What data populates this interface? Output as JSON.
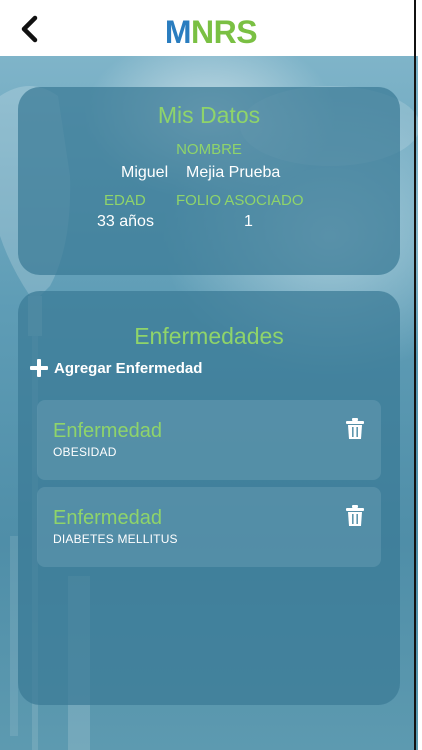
{
  "header": {
    "logo_m": "M",
    "logo_rest": "NRS",
    "back_icon": "chevron-left-icon"
  },
  "datos": {
    "title": "Mis Datos",
    "nombre_label": "NOMBRE",
    "nombre_first": "Miguel",
    "nombre_last": "Mejia Prueba",
    "edad_label": "EDAD",
    "edad_value": "33 años",
    "folio_label": "FOLIO ASOCIADO",
    "folio_value": "1"
  },
  "enfermedades": {
    "title": "Enfermedades",
    "add_label": "Agregar Enfermedad",
    "items": [
      {
        "title": "Enfermedad",
        "name": "OBESIDAD"
      },
      {
        "title": "Enfermedad",
        "name": "DIABETES MELLITUS"
      }
    ]
  },
  "colors": {
    "accent_green": "#8fd46a",
    "logo_blue": "#2a7dbf",
    "logo_green": "#7ac043",
    "card_bg": "#3a7a96"
  }
}
